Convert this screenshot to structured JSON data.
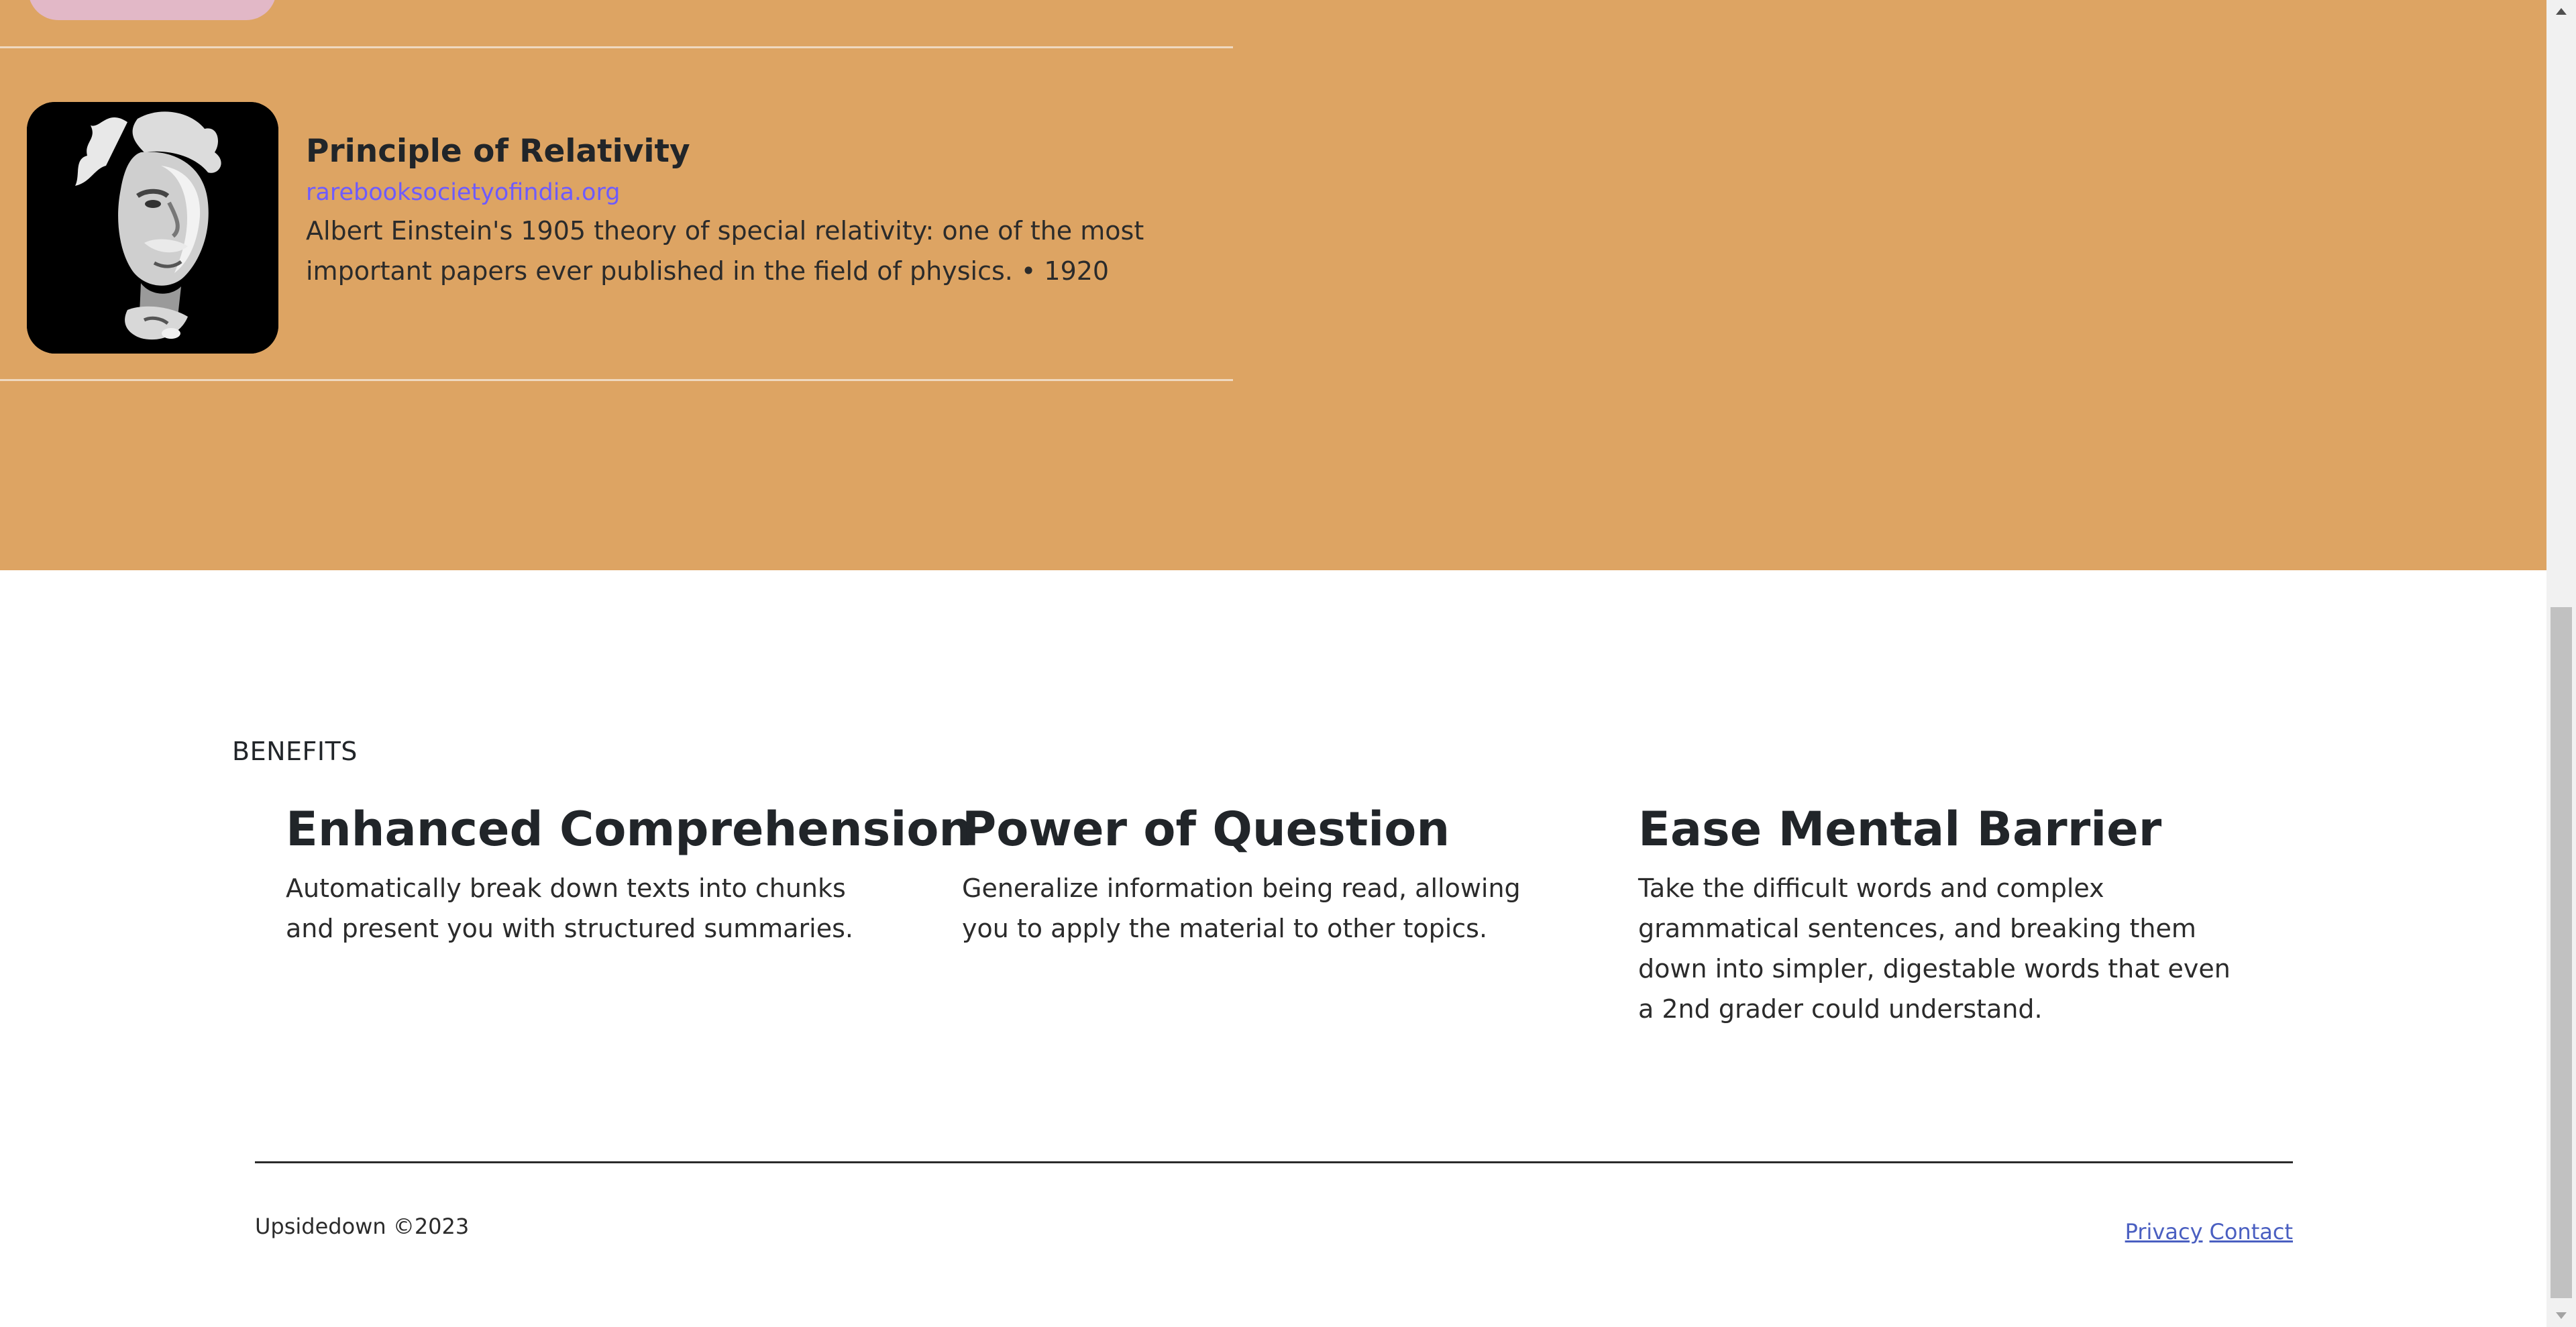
{
  "book": {
    "title": "Principle of Relativity",
    "source": "rarebooksocietyofindia.org",
    "description": "Albert Einstein's 1905 theory of special relativity: one of the most important papers ever published in the field of physics. • 1920",
    "thumbnail_icon": "einstein-portrait"
  },
  "benefits": {
    "eyebrow": "BENEFITS",
    "items": [
      {
        "title": "Enhanced Comprehension",
        "text": "Automatically break down texts into chunks and present you with structured summaries."
      },
      {
        "title": "Power of Question",
        "text": "Generalize information being read, allowing you to apply the material to other topics."
      },
      {
        "title": "Ease Mental Barrier",
        "text": "Take the difficult words and complex grammatical sentences, and breaking them down into simpler, digestable words that even a 2nd grader could understand."
      }
    ]
  },
  "footer": {
    "copyright": "Upsidedown ©2023",
    "links": {
      "privacy": "Privacy",
      "contact": "Contact"
    }
  },
  "colors": {
    "band": "#dda463",
    "link": "#6e5bff",
    "footer_link": "#4a5fc1"
  }
}
